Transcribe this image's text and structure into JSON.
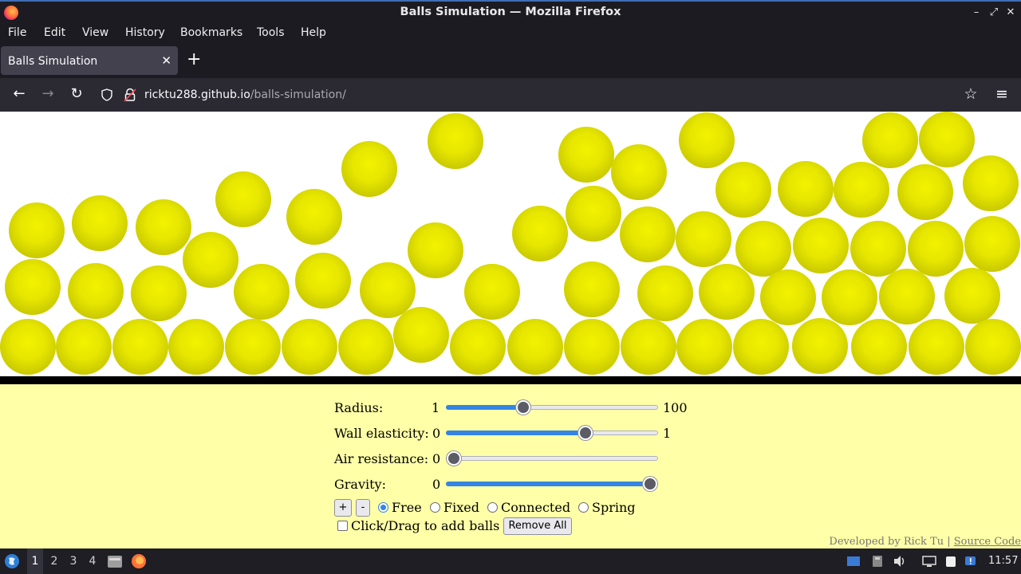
{
  "window": {
    "title": "Balls Simulation — Mozilla Firefox",
    "controls": [
      "–",
      "⤢",
      "✕"
    ]
  },
  "menu": [
    "File",
    "Edit",
    "View",
    "History",
    "Bookmarks",
    "Tools",
    "Help"
  ],
  "tab": {
    "label": "Balls Simulation",
    "close": "✕",
    "new": "+"
  },
  "nav": {
    "back": "←",
    "forward": "→",
    "reload": "↻",
    "url_host": "ricktu288.github.io",
    "url_path": "/balls-simulation/",
    "bookmark": "☆",
    "menu": "≡"
  },
  "controls": {
    "radius": {
      "label": "Radius:",
      "min": "1",
      "max": "100",
      "value": 36
    },
    "wall": {
      "label": "Wall elasticity:",
      "min": "0",
      "max": "1",
      "value": 0.67
    },
    "air": {
      "label": "Air resistance:",
      "min": "0",
      "value": 0
    },
    "gravity": {
      "label": "Gravity:",
      "min": "0",
      "value": 1.0
    },
    "add_btn": "+",
    "remove_btn": "-",
    "modes": [
      "Free",
      "Fixed",
      "Connected",
      "Spring"
    ],
    "selected_mode": "Free",
    "click_add": "Click/Drag to add balls",
    "remove_all": "Remove All"
  },
  "credits": {
    "text": "Developed by Rick Tu",
    "sep": "|",
    "link": "Source Code"
  },
  "taskbar": {
    "workspaces": [
      "1",
      "2",
      "3",
      "4"
    ],
    "active_workspace": "1",
    "clock": "11:57"
  },
  "colors": {
    "ball": "#e6e600",
    "page_bg": "#ffffa8",
    "accent": "#3584e4"
  }
}
